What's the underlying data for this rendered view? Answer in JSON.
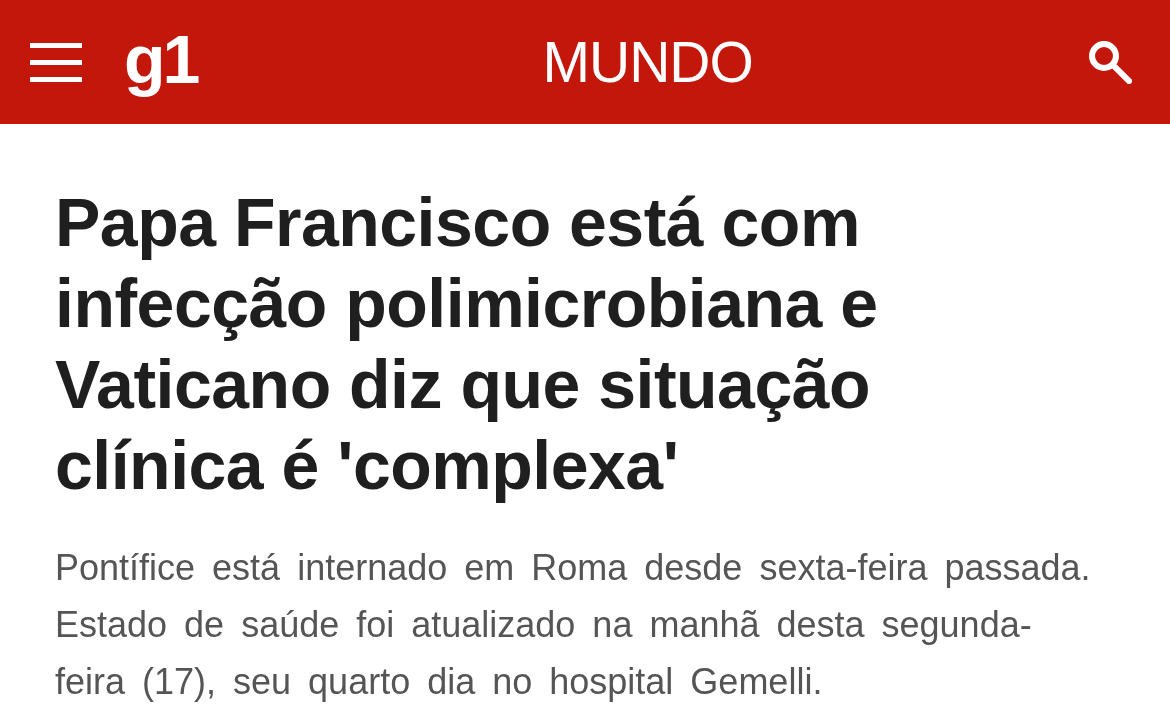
{
  "header": {
    "logo": "g1",
    "section": "MUNDO"
  },
  "article": {
    "headline": "Papa Francisco está com infecção polimicrobiana e Vaticano diz que situação clínica é 'complexa'",
    "subtitle": "Pontífice está internado em Roma desde sexta-feira passada. Estado de saúde foi atualizado na manhã desta segunda-feira (17), seu quarto dia no hospital Gemelli."
  }
}
